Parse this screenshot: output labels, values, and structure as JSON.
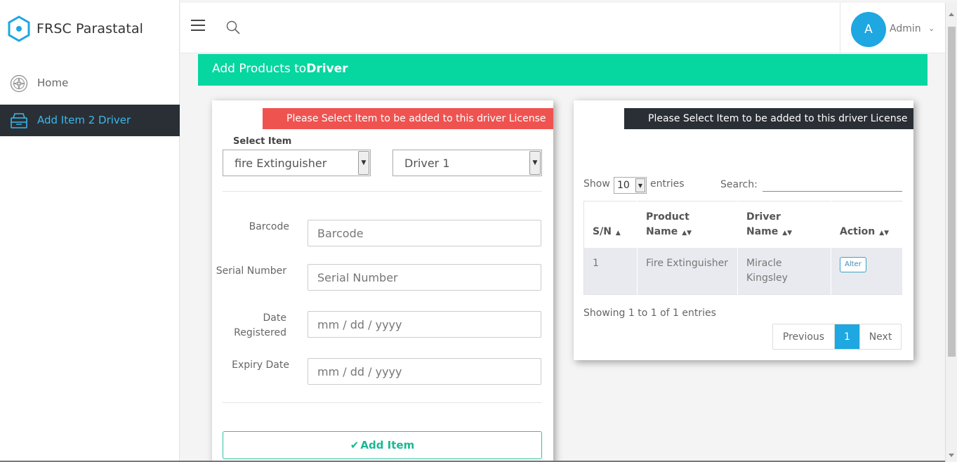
{
  "app": {
    "brand_name": "FRSC Parastatal"
  },
  "sidebar": {
    "items": [
      {
        "label": "Home",
        "icon": "compass-icon",
        "active": false
      },
      {
        "label": "Add Item 2 Driver",
        "icon": "inbox-icon",
        "active": true
      }
    ]
  },
  "header": {
    "user": {
      "avatar_letter": "A",
      "name": "Admin"
    }
  },
  "page": {
    "title_prefix": "Add Products to",
    "title_bold": "Driver"
  },
  "form_card": {
    "ribbon": "Please Select Item to be added to this driver License",
    "select_label": "Select Item",
    "item_select_value": "fire Extinguisher",
    "driver_select_value": "Driver 1",
    "fields": [
      {
        "label": "Barcode",
        "placeholder": "Barcode"
      },
      {
        "label": "Serial Number",
        "placeholder": "Serial Number"
      },
      {
        "label": "Date Registered",
        "placeholder": "mm / dd / yyyy"
      },
      {
        "label": "Expiry Date",
        "placeholder": "mm / dd / yyyy"
      }
    ],
    "submit_label": "Add Item"
  },
  "table_card": {
    "ribbon": "Please Select Item to be added to this driver License",
    "show_label": "Show",
    "entries_value": "10",
    "entries_label": "entries",
    "search_label": "Search:",
    "columns": [
      "S/N",
      "Product Name",
      "Driver Name",
      "Action"
    ],
    "rows": [
      {
        "sn": "1",
        "product": "Fire Extinguisher",
        "driver": "Miracle Kingsley",
        "action": "Alter"
      }
    ],
    "showing_text": "Showing 1 to 1 of 1 entries",
    "pagination": {
      "previous": "Previous",
      "current": "1",
      "next": "Next"
    }
  },
  "colors": {
    "banner": "#06d6a0",
    "ribbon_red": "#ef5350",
    "ribbon_dark": "#2a2f35",
    "accent_blue": "#1ea7e1"
  }
}
